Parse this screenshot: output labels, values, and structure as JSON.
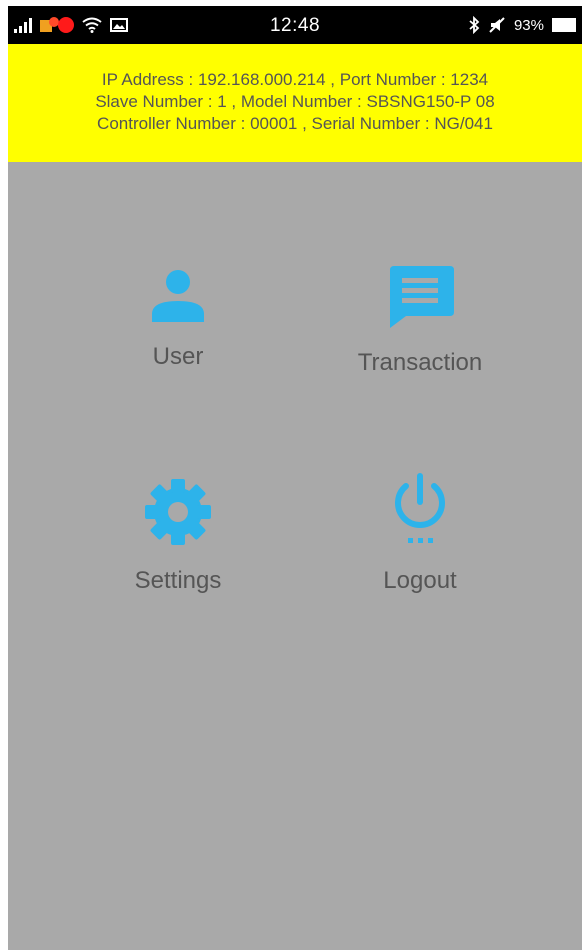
{
  "status_bar": {
    "time": "12:48",
    "battery_percent": "93%",
    "icons": [
      "signal-icon",
      "notification-icon",
      "wifi-icon",
      "gallery-icon",
      "bluetooth-icon",
      "mute-icon",
      "battery-icon"
    ]
  },
  "info": {
    "line1": "IP Address : 192.168.000.214 , Port Number : 1234",
    "line2": "Slave Number : 1 , Model Number :    SBSNG150-P 08",
    "line3": "Controller Number : 00001 , Serial Number : NG/041"
  },
  "menu": {
    "user_label": "User",
    "transaction_label": "Transaction",
    "settings_label": "Settings",
    "logout_label": "Logout"
  },
  "colors": {
    "accent": "#2db3ea",
    "banner": "#ffff00",
    "background": "#a9a9a9"
  }
}
